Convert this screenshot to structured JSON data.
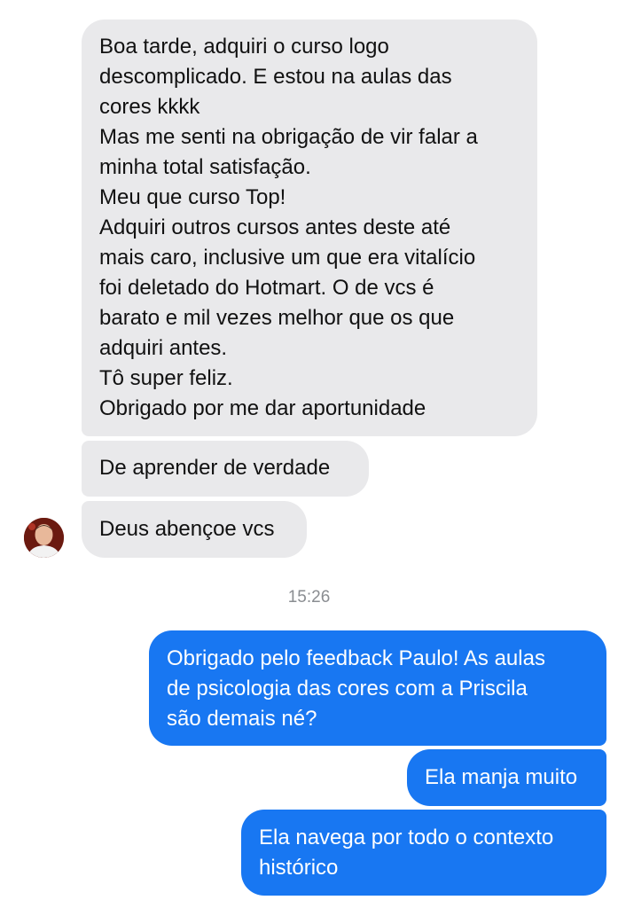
{
  "messages": [
    {
      "text": "Boa tarde, adquiri o curso logo\ndescomplicado. E estou na aulas das\ncores kkkk\nMas me senti na obrigação de vir falar a\nminha total satisfação.\nMeu que curso Top!\nAdquiri outros cursos antes deste até\nmais caro, inclusive um que era vitalício\nfoi deletado do Hotmart. O de vcs é\nbarato e mil vezes melhor que os que\nadquiri antes.\nTô super feliz.\nObrigado por me dar aportunidade"
    },
    {
      "text": "De aprender de verdade"
    },
    {
      "text": "Deus abençoe vcs"
    },
    {
      "text": "Obrigado pelo feedback Paulo! As aulas\nde psicologia das cores com a Priscila\nsão demais né?"
    },
    {
      "text": "Ela manja muito"
    },
    {
      "text": "Ela navega por todo o contexto\nhistórico"
    }
  ],
  "timestamp": "15:26",
  "colors": {
    "incoming_bubble": "#e9e9eb",
    "outgoing_bubble": "#1877f2",
    "timestamp_text": "#8a8d91"
  },
  "avatar_icon": "contact-avatar-photo"
}
